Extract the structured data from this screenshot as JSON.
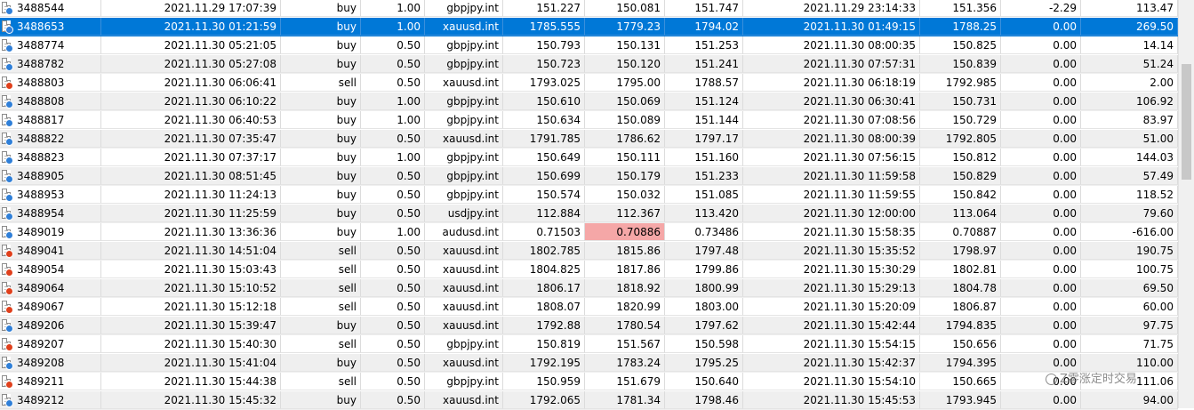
{
  "colors": {
    "selection": "#0078d7",
    "alt_row": "#efefef",
    "highlight_cell": "#f5a7a7",
    "buy_dot": "#2f7fd8",
    "sell_dot": "#e0401c"
  },
  "row_icon": "order-document-icon",
  "rows": [
    {
      "ticket": "3488544",
      "open_time": "2021.11.29 17:07:39",
      "type": "buy",
      "size": "1.00",
      "symbol": "gbpjpy.int",
      "price": "151.227",
      "sl": "150.081",
      "tp": "151.747",
      "close_time": "2021.11.29 23:14:33",
      "close_price": "151.356",
      "swap": "-2.29",
      "profit": "113.47"
    },
    {
      "ticket": "3488653",
      "open_time": "2021.11.30 01:21:59",
      "type": "buy",
      "size": "1.00",
      "symbol": "xauusd.int",
      "price": "1785.555",
      "sl": "1779.23",
      "tp": "1794.02",
      "close_time": "2021.11.30 01:49:15",
      "close_price": "1788.25",
      "swap": "0.00",
      "profit": "269.50",
      "selected": true
    },
    {
      "ticket": "3488774",
      "open_time": "2021.11.30 05:21:05",
      "type": "buy",
      "size": "0.50",
      "symbol": "gbpjpy.int",
      "price": "150.793",
      "sl": "150.131",
      "tp": "151.253",
      "close_time": "2021.11.30 08:00:35",
      "close_price": "150.825",
      "swap": "0.00",
      "profit": "14.14"
    },
    {
      "ticket": "3488782",
      "open_time": "2021.11.30 05:27:08",
      "type": "buy",
      "size": "0.50",
      "symbol": "gbpjpy.int",
      "price": "150.723",
      "sl": "150.120",
      "tp": "151.241",
      "close_time": "2021.11.30 07:57:31",
      "close_price": "150.839",
      "swap": "0.00",
      "profit": "51.24"
    },
    {
      "ticket": "3488803",
      "open_time": "2021.11.30 06:06:41",
      "type": "sell",
      "size": "0.50",
      "symbol": "xauusd.int",
      "price": "1793.025",
      "sl": "1795.00",
      "tp": "1788.57",
      "close_time": "2021.11.30 06:18:19",
      "close_price": "1792.985",
      "swap": "0.00",
      "profit": "2.00"
    },
    {
      "ticket": "3488808",
      "open_time": "2021.11.30 06:10:22",
      "type": "buy",
      "size": "1.00",
      "symbol": "gbpjpy.int",
      "price": "150.610",
      "sl": "150.069",
      "tp": "151.124",
      "close_time": "2021.11.30 06:30:41",
      "close_price": "150.731",
      "swap": "0.00",
      "profit": "106.92"
    },
    {
      "ticket": "3488817",
      "open_time": "2021.11.30 06:40:53",
      "type": "buy",
      "size": "1.00",
      "symbol": "gbpjpy.int",
      "price": "150.634",
      "sl": "150.089",
      "tp": "151.144",
      "close_time": "2021.11.30 07:08:56",
      "close_price": "150.729",
      "swap": "0.00",
      "profit": "83.97"
    },
    {
      "ticket": "3488822",
      "open_time": "2021.11.30 07:35:47",
      "type": "buy",
      "size": "0.50",
      "symbol": "xauusd.int",
      "price": "1791.785",
      "sl": "1786.62",
      "tp": "1797.17",
      "close_time": "2021.11.30 08:00:39",
      "close_price": "1792.805",
      "swap": "0.00",
      "profit": "51.00"
    },
    {
      "ticket": "3488823",
      "open_time": "2021.11.30 07:37:17",
      "type": "buy",
      "size": "1.00",
      "symbol": "gbpjpy.int",
      "price": "150.649",
      "sl": "150.111",
      "tp": "151.160",
      "close_time": "2021.11.30 07:56:15",
      "close_price": "150.812",
      "swap": "0.00",
      "profit": "144.03"
    },
    {
      "ticket": "3488905",
      "open_time": "2021.11.30 08:51:45",
      "type": "buy",
      "size": "0.50",
      "symbol": "gbpjpy.int",
      "price": "150.699",
      "sl": "150.179",
      "tp": "151.233",
      "close_time": "2021.11.30 11:59:58",
      "close_price": "150.829",
      "swap": "0.00",
      "profit": "57.49"
    },
    {
      "ticket": "3488953",
      "open_time": "2021.11.30 11:24:13",
      "type": "buy",
      "size": "0.50",
      "symbol": "gbpjpy.int",
      "price": "150.574",
      "sl": "150.032",
      "tp": "151.085",
      "close_time": "2021.11.30 11:59:55",
      "close_price": "150.842",
      "swap": "0.00",
      "profit": "118.52"
    },
    {
      "ticket": "3488954",
      "open_time": "2021.11.30 11:25:59",
      "type": "buy",
      "size": "0.50",
      "symbol": "usdjpy.int",
      "price": "112.884",
      "sl": "112.367",
      "tp": "113.420",
      "close_time": "2021.11.30 12:00:00",
      "close_price": "113.064",
      "swap": "0.00",
      "profit": "79.60"
    },
    {
      "ticket": "3489019",
      "open_time": "2021.11.30 13:36:36",
      "type": "buy",
      "size": "1.00",
      "symbol": "audusd.int",
      "price": "0.71503",
      "sl": "0.70886",
      "tp": "0.73486",
      "close_time": "2021.11.30 15:58:35",
      "close_price": "0.70887",
      "swap": "0.00",
      "profit": "-616.00",
      "sl_highlight": true
    },
    {
      "ticket": "3489041",
      "open_time": "2021.11.30 14:51:04",
      "type": "sell",
      "size": "0.50",
      "symbol": "xauusd.int",
      "price": "1802.785",
      "sl": "1815.86",
      "tp": "1797.48",
      "close_time": "2021.11.30 15:35:52",
      "close_price": "1798.97",
      "swap": "0.00",
      "profit": "190.75"
    },
    {
      "ticket": "3489054",
      "open_time": "2021.11.30 15:03:43",
      "type": "sell",
      "size": "0.50",
      "symbol": "xauusd.int",
      "price": "1804.825",
      "sl": "1817.86",
      "tp": "1799.86",
      "close_time": "2021.11.30 15:30:29",
      "close_price": "1802.81",
      "swap": "0.00",
      "profit": "100.75"
    },
    {
      "ticket": "3489064",
      "open_time": "2021.11.30 15:10:52",
      "type": "sell",
      "size": "0.50",
      "symbol": "xauusd.int",
      "price": "1806.17",
      "sl": "1818.92",
      "tp": "1800.99",
      "close_time": "2021.11.30 15:29:13",
      "close_price": "1804.78",
      "swap": "0.00",
      "profit": "69.50"
    },
    {
      "ticket": "3489067",
      "open_time": "2021.11.30 15:12:18",
      "type": "sell",
      "size": "0.50",
      "symbol": "xauusd.int",
      "price": "1808.07",
      "sl": "1820.99",
      "tp": "1803.00",
      "close_time": "2021.11.30 15:20:09",
      "close_price": "1806.87",
      "swap": "0.00",
      "profit": "60.00"
    },
    {
      "ticket": "3489206",
      "open_time": "2021.11.30 15:39:47",
      "type": "buy",
      "size": "0.50",
      "symbol": "xauusd.int",
      "price": "1792.88",
      "sl": "1780.54",
      "tp": "1797.62",
      "close_time": "2021.11.30 15:42:44",
      "close_price": "1794.835",
      "swap": "0.00",
      "profit": "97.75"
    },
    {
      "ticket": "3489207",
      "open_time": "2021.11.30 15:40:30",
      "type": "sell",
      "size": "0.50",
      "symbol": "gbpjpy.int",
      "price": "150.819",
      "sl": "151.567",
      "tp": "150.598",
      "close_time": "2021.11.30 15:54:15",
      "close_price": "150.656",
      "swap": "0.00",
      "profit": "71.75"
    },
    {
      "ticket": "3489208",
      "open_time": "2021.11.30 15:41:04",
      "type": "buy",
      "size": "0.50",
      "symbol": "xauusd.int",
      "price": "1792.195",
      "sl": "1783.24",
      "tp": "1795.25",
      "close_time": "2021.11.30 15:42:37",
      "close_price": "1794.395",
      "swap": "0.00",
      "profit": "110.00"
    },
    {
      "ticket": "3489211",
      "open_time": "2021.11.30 15:44:38",
      "type": "sell",
      "size": "0.50",
      "symbol": "gbpjpy.int",
      "price": "150.959",
      "sl": "151.679",
      "tp": "150.640",
      "close_time": "2021.11.30 15:54:10",
      "close_price": "150.665",
      "swap": "0.00",
      "profit": "111.06"
    },
    {
      "ticket": "3489212",
      "open_time": "2021.11.30 15:45:32",
      "type": "buy",
      "size": "0.50",
      "symbol": "xauusd.int",
      "price": "1792.065",
      "sl": "1781.34",
      "tp": "1798.46",
      "close_time": "2021.11.30 15:45:53",
      "close_price": "1793.945",
      "swap": "0.00",
      "profit": "94.00"
    }
  ],
  "watermark": {
    "text": "Z零涨定时交易",
    "icon": "wechat-channel-icon"
  }
}
